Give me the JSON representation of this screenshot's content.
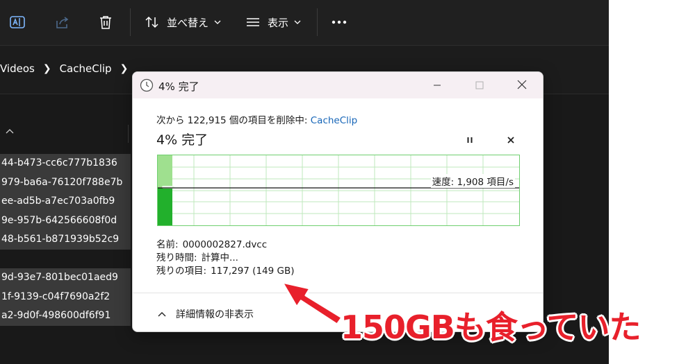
{
  "toolbar": {
    "sort_label": "並べ替え",
    "view_label": "表示"
  },
  "breadcrumb": {
    "items": [
      "Videos",
      "CacheClip"
    ]
  },
  "file_rows": [
    "44-b473-cc6c777b1836",
    "979-ba6a-76120f788e7b",
    "ee-ad5b-a7ec703a0fb9",
    "9e-957b-642566608f0d",
    "48-b561-b871939b52c9",
    "",
    "9d-93e7-801bec01aed9",
    "1f-9139-c04f7690a2f2",
    "a2-9d0f-498600df6f91"
  ],
  "dialog": {
    "title": "4% 完了",
    "summary_prefix": "次から 122,915 個の項目を削除中: ",
    "summary_dest": "CacheClip",
    "percent_label": "4% 完了",
    "progress_percent": 4,
    "speed_label": "速度: 1,908 項目/s",
    "details": {
      "name_key": "名前:",
      "name_value": "0000002827.dvcc",
      "time_key": "残り時間:",
      "time_value": "計算中...",
      "items_key": "残りの項目:",
      "items_value": "117,297 (149 GB)"
    },
    "toggle_label": "詳細情報の非表示"
  },
  "annotation": {
    "text": "150GBも食っていた",
    "color": "#e8202b"
  },
  "colors": {
    "explorer_bg": "#191919",
    "graph_fill": "#22b02c",
    "graph_fill_light": "#9fe08f",
    "link": "#1766b8"
  }
}
